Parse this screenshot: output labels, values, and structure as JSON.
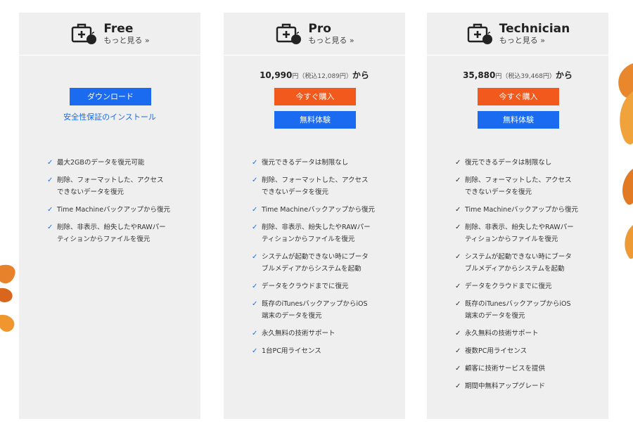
{
  "colors": {
    "card_bg": "#efefef",
    "blue": "#1a6bf0",
    "orange": "#f2591d",
    "check_blue": "#1a6bf0",
    "check_dark": "#333333"
  },
  "plans": [
    {
      "title": "Free",
      "more": "もっと見る »",
      "download_label": "ダウンロード",
      "safe_install_label": "安全性保証のインストール",
      "features": [
        "最大2GBのデータを復元可能",
        "削除、フォーマットした、アクセス\nできないデータを復元",
        "Time Machineバックアップから復元",
        "削除、非表示、紛失したやRAWパー\nティションからファイルを復元"
      ]
    },
    {
      "title": "Pro",
      "more": "もっと見る »",
      "price": "10,990",
      "price_unit": "円",
      "tax_note": "（税込12,089円）",
      "price_suffix": "から",
      "buy_label": "今すぐ購入",
      "trial_label": "無料体験",
      "features": [
        "復元できるデータは制限なし",
        "削除、フォーマットした、アクセス\nできないデータを復元",
        "Time Machineバックアップから復元",
        "削除、非表示、紛失したやRAWパー\nティションからファイルを復元",
        "システムが起動できない時にブータ\nブルメディアからシステムを起動",
        "データをクラウドまでに復元",
        "既存のiTunesバックアップからiOS\n端末のデータを復元",
        "永久無料の技術サポート",
        "1台PC用ライセンス"
      ]
    },
    {
      "title": "Technician",
      "more": "もっと見る »",
      "price": "35,880",
      "price_unit": "円",
      "tax_note": "（税込39,468円）",
      "price_suffix": "から",
      "buy_label": "今すぐ購入",
      "trial_label": "無料体験",
      "features": [
        "復元できるデータは制限なし",
        "削除、フォーマットした、アクセス\nできないデータを復元",
        "Time Machineバックアップから復元",
        "削除、非表示、紛失したやRAWパー\nティションからファイルを復元",
        "システムが起動できない時にブータ\nブルメディアからシステムを起動",
        "データをクラウドまでに復元",
        "既存のiTunesバックアップからiOS\n端末のデータを復元",
        "永久無料の技術サポート",
        "複数PC用ライセンス",
        "顧客に技術サービスを提供",
        "期間中無料アップグレード"
      ]
    }
  ]
}
